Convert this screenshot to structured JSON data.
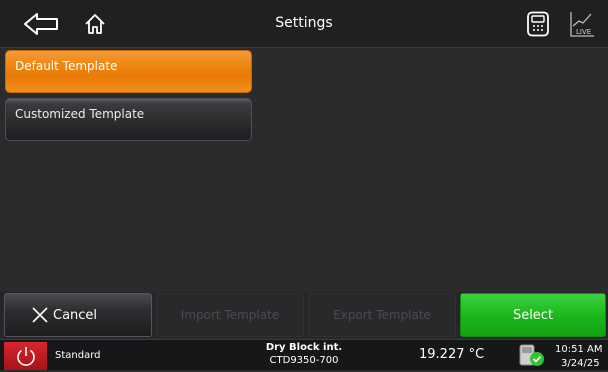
{
  "header": {
    "title": "Settings",
    "icons": [
      "back-arrow-icon",
      "home-icon",
      "calculator-icon",
      "live-chart-icon"
    ],
    "live_label": "LIVE"
  },
  "templates": {
    "items": [
      {
        "label": "Default Template",
        "selected": true
      },
      {
        "label": "Customized Template",
        "selected": false
      }
    ]
  },
  "actions": {
    "cancel": "Cancel",
    "import": "Import Template",
    "export": "Export Template",
    "select": "Select"
  },
  "status": {
    "mode": "Standard",
    "device_name": "Dry Block int.",
    "device_model": "CTD9350-700",
    "temperature": "19.227 °C",
    "time": "10:51 AM",
    "date": "3/24/25"
  },
  "colors": {
    "accent_selected": "#ef8a16",
    "select_button": "#1bb81b",
    "power_button": "#c41e24"
  }
}
